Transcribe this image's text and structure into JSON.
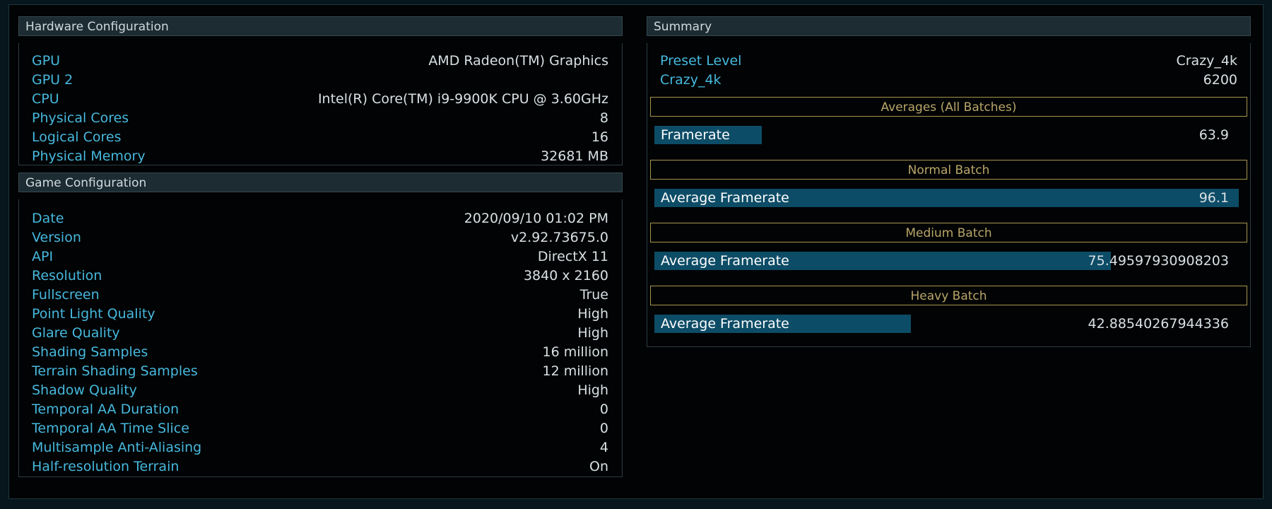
{
  "hardware": {
    "title": "Hardware Configuration",
    "rows": [
      {
        "label": "GPU",
        "value": "AMD Radeon(TM) Graphics"
      },
      {
        "label": "GPU 2",
        "value": ""
      },
      {
        "label": "CPU",
        "value": "Intel(R) Core(TM) i9-9900K CPU @ 3.60GHz"
      },
      {
        "label": "Physical Cores",
        "value": "8"
      },
      {
        "label": "Logical Cores",
        "value": "16"
      },
      {
        "label": "Physical Memory",
        "value": "32681 MB"
      }
    ]
  },
  "game": {
    "title": "Game Configuration",
    "rows": [
      {
        "label": "Date",
        "value": "2020/09/10 01:02 PM"
      },
      {
        "label": "Version",
        "value": "v2.92.73675.0"
      },
      {
        "label": "API",
        "value": "DirectX 11"
      },
      {
        "label": "Resolution",
        "value": "3840 x 2160"
      },
      {
        "label": "Fullscreen",
        "value": "True"
      },
      {
        "label": "Point Light Quality",
        "value": "High"
      },
      {
        "label": "Glare Quality",
        "value": "High"
      },
      {
        "label": "Shading Samples",
        "value": "16 million"
      },
      {
        "label": "Terrain Shading Samples",
        "value": "12 million"
      },
      {
        "label": "Shadow Quality",
        "value": "High"
      },
      {
        "label": "Temporal AA Duration",
        "value": "0"
      },
      {
        "label": "Temporal AA Time Slice",
        "value": "0"
      },
      {
        "label": "Multisample Anti-Aliasing",
        "value": "4"
      },
      {
        "label": "Half-resolution Terrain",
        "value": "On"
      }
    ]
  },
  "summary": {
    "title": "Summary",
    "preset_label": "Preset Level",
    "preset_value": "Crazy_4k",
    "score_label": "Crazy_4k",
    "score_value": "6200",
    "batches": [
      {
        "title": "Averages (All Batches)",
        "bar_label": "Framerate",
        "value": "63.9",
        "fill_fraction": 0.184
      },
      {
        "title": "Normal Batch",
        "bar_label": "Average Framerate",
        "value": "96.1",
        "fill_fraction": 1.0
      },
      {
        "title": "Medium Batch",
        "bar_label": "Average Framerate",
        "value": "75.49597930908203",
        "fill_fraction": 0.781
      },
      {
        "title": "Heavy Batch",
        "bar_label": "Average Framerate",
        "value": "42.88540267944336",
        "fill_fraction": 0.439
      }
    ]
  },
  "colors": {
    "label": "#47b8dd",
    "value": "#d8e0e4",
    "bar": "#0d4c66",
    "batch_title": "#b9a66a"
  }
}
